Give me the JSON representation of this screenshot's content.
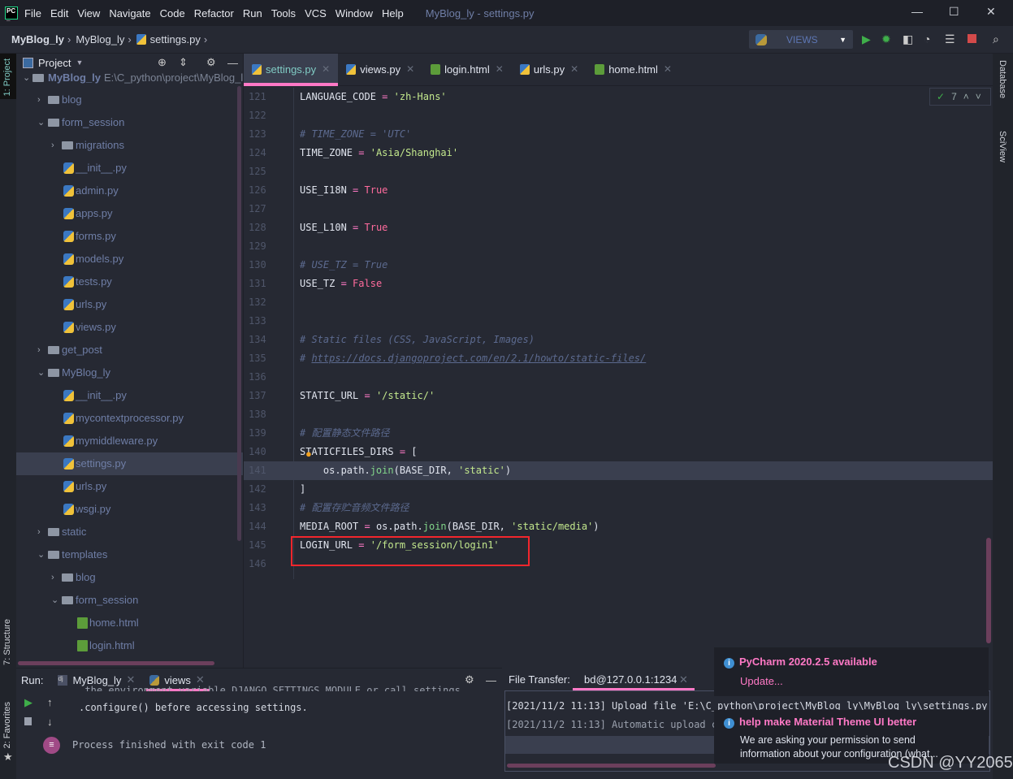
{
  "titlebar": {
    "menu": [
      "File",
      "Edit",
      "View",
      "Navigate",
      "Code",
      "Refactor",
      "Run",
      "Tools",
      "VCS",
      "Window",
      "Help"
    ],
    "title": "MyBlog_ly - settings.py",
    "logo": "PC"
  },
  "breadcrumb": [
    "MyBlog_ly",
    "MyBlog_ly",
    "settings.py"
  ],
  "toolbar": {
    "run_config": "VIEWS"
  },
  "sidestrips": {
    "left": [
      "1: Project",
      "7: Structure",
      "2: Favorites"
    ],
    "right": [
      "Database",
      "SciView"
    ]
  },
  "project": {
    "header": "Project",
    "root": {
      "name": "MyBlog_ly",
      "path": "E:\\C_python\\project\\MyBlog_l"
    },
    "items": [
      {
        "label": "blog",
        "level": 1,
        "type": "folder",
        "expanded": false
      },
      {
        "label": "form_session",
        "level": 1,
        "type": "folder",
        "expanded": true
      },
      {
        "label": "migrations",
        "level": 2,
        "type": "folder",
        "expanded": false
      },
      {
        "label": "__init__.py",
        "level": 2,
        "type": "py"
      },
      {
        "label": "admin.py",
        "level": 2,
        "type": "py"
      },
      {
        "label": "apps.py",
        "level": 2,
        "type": "py"
      },
      {
        "label": "forms.py",
        "level": 2,
        "type": "py"
      },
      {
        "label": "models.py",
        "level": 2,
        "type": "py"
      },
      {
        "label": "tests.py",
        "level": 2,
        "type": "py"
      },
      {
        "label": "urls.py",
        "level": 2,
        "type": "py"
      },
      {
        "label": "views.py",
        "level": 2,
        "type": "py"
      },
      {
        "label": "get_post",
        "level": 1,
        "type": "folder",
        "expanded": false
      },
      {
        "label": "MyBlog_ly",
        "level": 1,
        "type": "folder",
        "expanded": true
      },
      {
        "label": "__init__.py",
        "level": 2,
        "type": "py"
      },
      {
        "label": "mycontextprocessor.py",
        "level": 2,
        "type": "py"
      },
      {
        "label": "mymiddleware.py",
        "level": 2,
        "type": "py"
      },
      {
        "label": "settings.py",
        "level": 2,
        "type": "py",
        "selected": true
      },
      {
        "label": "urls.py",
        "level": 2,
        "type": "py"
      },
      {
        "label": "wsgi.py",
        "level": 2,
        "type": "py"
      },
      {
        "label": "static",
        "level": 1,
        "type": "folder",
        "expanded": false
      },
      {
        "label": "templates",
        "level": 1,
        "type": "folder",
        "expanded": true
      },
      {
        "label": "blog",
        "level": 2,
        "type": "folder",
        "expanded": false
      },
      {
        "label": "form_session",
        "level": 2,
        "type": "folder",
        "expanded": true
      },
      {
        "label": "home.html",
        "level": 3,
        "type": "html"
      },
      {
        "label": "login.html",
        "level": 3,
        "type": "html"
      }
    ]
  },
  "editor_tabs": [
    {
      "label": "settings.py",
      "type": "py",
      "active": true
    },
    {
      "label": "views.py",
      "type": "py"
    },
    {
      "label": "login.html",
      "type": "html"
    },
    {
      "label": "urls.py",
      "type": "py"
    },
    {
      "label": "home.html",
      "type": "html"
    }
  ],
  "inspection": {
    "count": "7"
  },
  "code": [
    {
      "n": "121",
      "t": [
        [
          "id",
          "LANGUAGE_CODE "
        ],
        [
          "op",
          "="
        ],
        [
          "id",
          " "
        ],
        [
          "str",
          "'zh-Hans'"
        ]
      ]
    },
    {
      "n": "122",
      "t": []
    },
    {
      "n": "123",
      "t": [
        [
          "cm",
          "# TIME_ZONE = 'UTC'"
        ]
      ]
    },
    {
      "n": "124",
      "t": [
        [
          "id",
          "TIME_ZONE "
        ],
        [
          "op",
          "="
        ],
        [
          "id",
          " "
        ],
        [
          "str",
          "'Asia/Shanghai'"
        ]
      ]
    },
    {
      "n": "125",
      "t": []
    },
    {
      "n": "126",
      "t": [
        [
          "id",
          "USE_I18N "
        ],
        [
          "op",
          "="
        ],
        [
          "id",
          " "
        ],
        [
          "kw",
          "True"
        ]
      ]
    },
    {
      "n": "127",
      "t": []
    },
    {
      "n": "128",
      "t": [
        [
          "id",
          "USE_L10N "
        ],
        [
          "op",
          "="
        ],
        [
          "id",
          " "
        ],
        [
          "kw",
          "True"
        ]
      ]
    },
    {
      "n": "129",
      "t": []
    },
    {
      "n": "130",
      "t": [
        [
          "cm",
          "# USE_TZ = True"
        ]
      ]
    },
    {
      "n": "131",
      "t": [
        [
          "id",
          "USE_TZ "
        ],
        [
          "op",
          "="
        ],
        [
          "id",
          " "
        ],
        [
          "kw",
          "False"
        ]
      ]
    },
    {
      "n": "132",
      "t": []
    },
    {
      "n": "133",
      "t": []
    },
    {
      "n": "134",
      "t": [
        [
          "cm",
          "# Static files (CSS, JavaScript, Images)"
        ]
      ]
    },
    {
      "n": "135",
      "t": [
        [
          "cm",
          "# "
        ],
        [
          "url",
          "https://docs.djangoproject.com/en/2.1/howto/static-files/"
        ]
      ]
    },
    {
      "n": "136",
      "t": []
    },
    {
      "n": "137",
      "t": [
        [
          "id",
          "STATIC_URL "
        ],
        [
          "op",
          "="
        ],
        [
          "id",
          " "
        ],
        [
          "str",
          "'/static/'"
        ]
      ]
    },
    {
      "n": "138",
      "t": []
    },
    {
      "n": "139",
      "t": [
        [
          "cm",
          "# 配置静态文件路径"
        ]
      ]
    },
    {
      "n": "140",
      "t": [
        [
          "id",
          "STATICFILES_DIRS "
        ],
        [
          "op",
          "="
        ],
        [
          "id",
          " ["
        ]
      ]
    },
    {
      "n": "141",
      "t": [
        [
          "id",
          "    os.path."
        ],
        [
          "fn",
          "join"
        ],
        [
          "id",
          "(BASE_DIR, "
        ],
        [
          "str",
          "'static'"
        ],
        [
          "id",
          ")"
        ]
      ],
      "current": true
    },
    {
      "n": "142",
      "t": [
        [
          "id",
          "]"
        ]
      ]
    },
    {
      "n": "143",
      "t": [
        [
          "cm",
          "# 配置存贮音频文件路径"
        ]
      ]
    },
    {
      "n": "144",
      "t": [
        [
          "id",
          "MEDIA_ROOT "
        ],
        [
          "op",
          "="
        ],
        [
          "id",
          " os.path."
        ],
        [
          "fn",
          "join"
        ],
        [
          "id",
          "(BASE_DIR, "
        ],
        [
          "str",
          "'static/media'"
        ],
        [
          "id",
          ")"
        ]
      ]
    },
    {
      "n": "145",
      "t": [
        [
          "id",
          "LOGIN_URL "
        ],
        [
          "op",
          "="
        ],
        [
          "id",
          " "
        ],
        [
          "str",
          "'/form_session/login1'"
        ]
      ]
    },
    {
      "n": "146",
      "t": []
    }
  ],
  "run": {
    "label": "Run:",
    "tabs": [
      "MyBlog_ly",
      "views"
    ],
    "output": [
      "  the environment variable DJANGO_SETTINGS_MODULE or call settings",
      ".configure() before accessing settings.",
      "Process finished with exit code 1"
    ]
  },
  "file_transfer": {
    "label": "File Transfer:",
    "tab": "bd@127.0.0.1:1234",
    "log": [
      "[2021/11/2 11:13] Upload file 'E:\\C_python\\project\\MyBlog_ly\\MyBlog_ly\\settings.py' t",
      "[2021/11/2 11:13] Automatic upload co"
    ]
  },
  "notifications": [
    {
      "title": "PyCharm 2020.2.5 available",
      "link": "Update..."
    },
    {
      "title": "help make Material Theme UI better",
      "body": "We are asking your permission to send information about your configuration (what..."
    }
  ],
  "watermark": "CSDN @YY2065",
  "colors": {
    "accent": "#ff79c6",
    "string": "#c3e88d",
    "keyword": "#ff6b9d",
    "comment": "#5c6a8f",
    "highlight_box": "#f2262d"
  }
}
